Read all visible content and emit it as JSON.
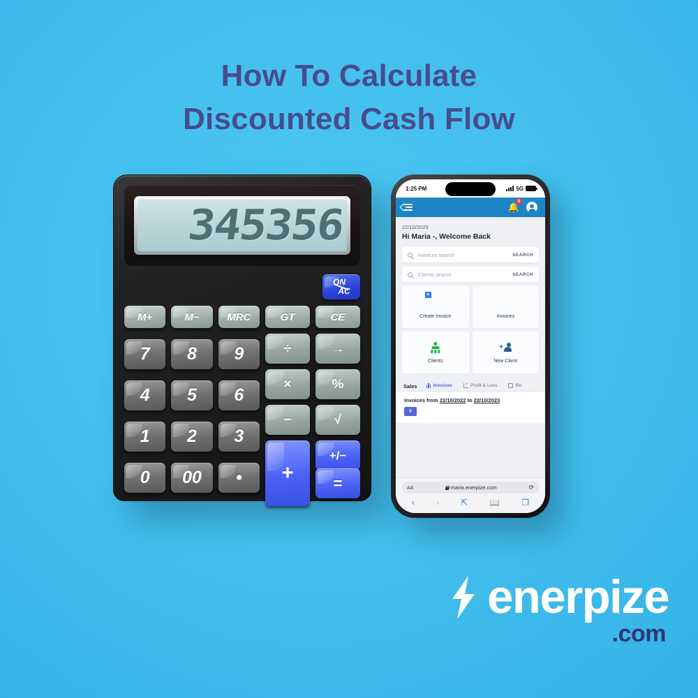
{
  "poster": {
    "background_color": "#47c4f2",
    "title_color": "#474c8f",
    "title_lines": [
      "How To Calculate",
      "Discounted Cash Flow"
    ]
  },
  "calculator": {
    "display_value": "345356",
    "power_key": {
      "top": "ON",
      "bottom": "AC"
    },
    "memory_keys": [
      "M+",
      "M−",
      "MRC",
      "GT",
      "CE"
    ],
    "number_keys": [
      "7",
      "8",
      "9",
      "4",
      "5",
      "6",
      "1",
      "2",
      "3",
      "0",
      "00",
      "•"
    ],
    "operator_keys": [
      "÷",
      "→",
      "×",
      "%",
      "−",
      "√"
    ],
    "blue_keys": {
      "plus": "+",
      "sign": "+/−",
      "equals": "="
    },
    "accent_color": "#4a62f5"
  },
  "phone": {
    "status_bar": {
      "time": "1:25 PM",
      "network": "5G"
    },
    "app_header": {
      "menu_icon": "hamburger-back-icon",
      "notification_badge": "0",
      "header_color": "#1a82c4"
    },
    "content": {
      "date": "22/10/2023",
      "greeting": "Hi Maria -, Welcome Back",
      "searches": [
        {
          "placeholder": "Invoices search",
          "button": "SEARCH"
        },
        {
          "placeholder": "Clients search",
          "button": "SEARCH"
        }
      ],
      "tiles": [
        {
          "label": "Create Invoice",
          "icon": "document-plus-icon",
          "color": "#2b7fe0"
        },
        {
          "label": "Invoices",
          "icon": "document-lines-icon",
          "color": "#1ba5bf"
        },
        {
          "label": "Clients",
          "icon": "people-group-icon",
          "color": "#24b24c"
        },
        {
          "label": "New Client",
          "icon": "person-plus-icon",
          "color": "#2e5d8c"
        }
      ],
      "tabs_section_title": "Sales",
      "tabs": [
        {
          "label": "Invoices",
          "icon": "bar-chart-icon",
          "active": true
        },
        {
          "label": "Profit & Loss",
          "icon": "line-chart-icon",
          "active": false
        },
        {
          "label": "Re",
          "icon": "page-icon",
          "active": false
        }
      ],
      "invoices_range": {
        "prefix": "Invoices from",
        "date_from": "22/10/2022",
        "middle": "to",
        "date_to": "22/10/2023",
        "badge_count": "0"
      }
    },
    "safari": {
      "text_size_button": "AA",
      "url": "maria.enerpize.com",
      "reload_icon": "reload-icon",
      "nav": [
        "back-icon",
        "forward-icon",
        "share-icon",
        "bookmarks-icon",
        "tabs-icon"
      ]
    }
  },
  "logo": {
    "wordmark": "enerpize",
    "tld": ".com",
    "wordmark_color": "#ffffff",
    "tld_color": "#2f3573",
    "bolt_icon": "lightning-bolt-icon"
  }
}
